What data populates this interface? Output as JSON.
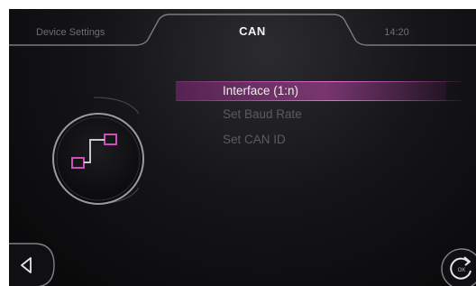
{
  "header": {
    "left_tab": "Device Settings",
    "title": "CAN",
    "clock": "14:20"
  },
  "menu": {
    "items": [
      {
        "label": "Interface (1:n)",
        "selected": true
      },
      {
        "label": "Set Baud Rate",
        "selected": false
      },
      {
        "label": "Set CAN ID",
        "selected": false
      }
    ]
  },
  "icons": {
    "section_icon": "can-interface-icon",
    "back": "back-triangle-icon",
    "ok": "ok-refresh-icon",
    "ok_label": "OK"
  },
  "colors": {
    "accent": "#c850b8",
    "highlight": "#a23c96",
    "background": "#0c0c0e"
  }
}
